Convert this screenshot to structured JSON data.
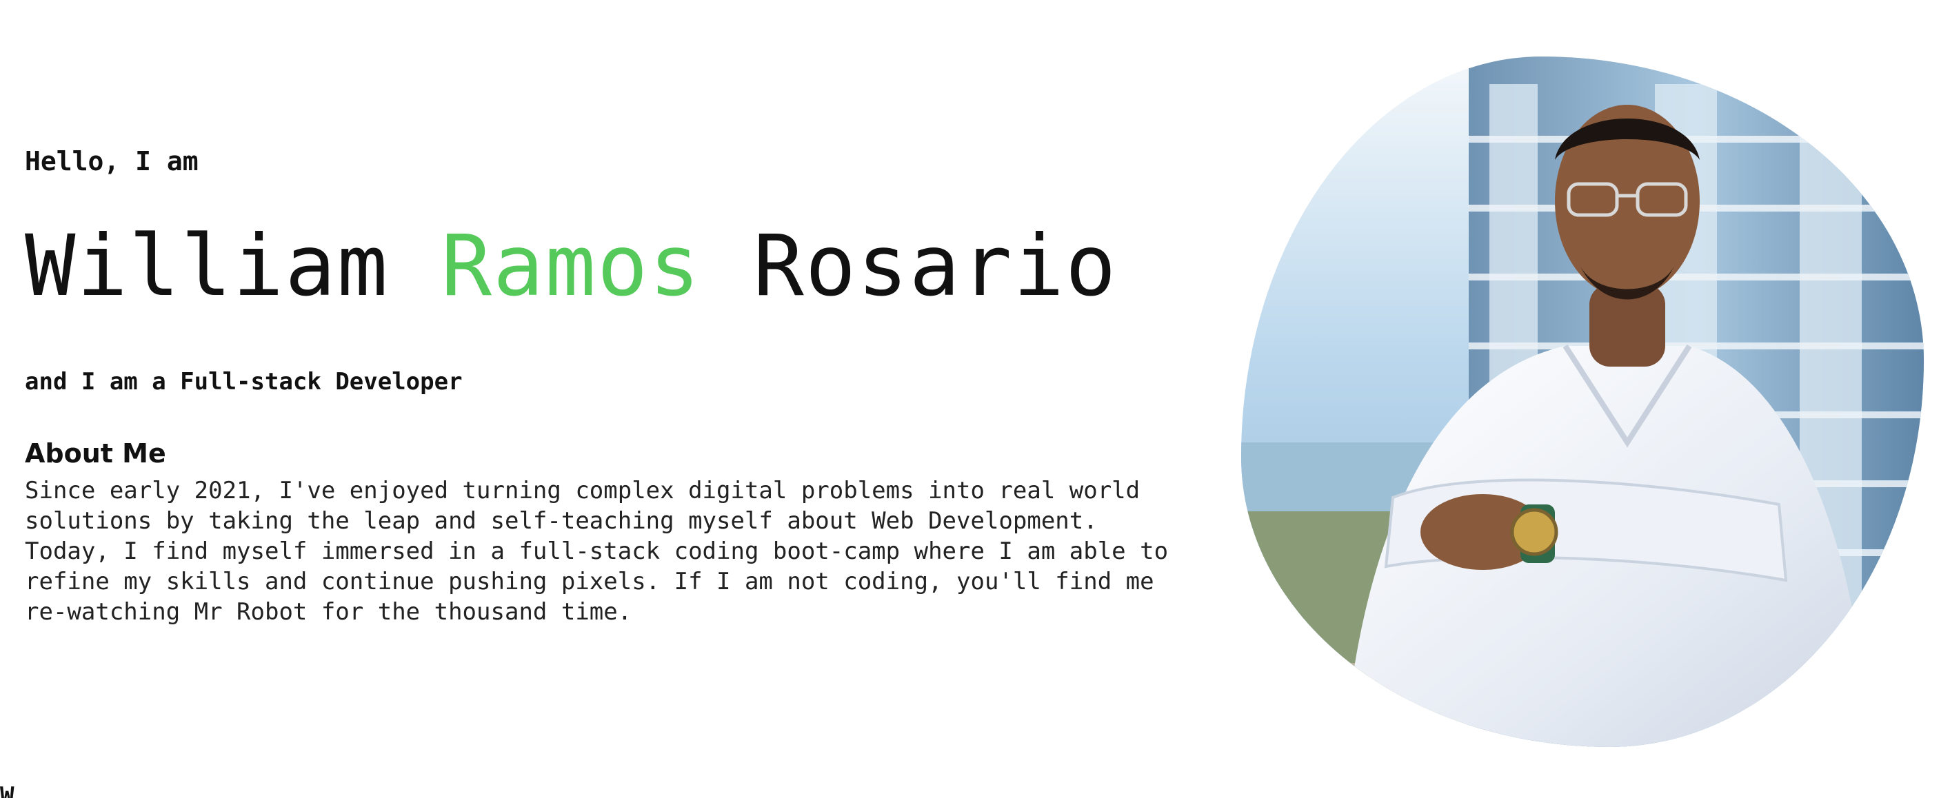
{
  "hero": {
    "greeting": "Hello, I am",
    "name_first": "William",
    "name_middle": "Ramos",
    "name_last": "Rosario",
    "tagline": "and I am a Full-stack Developer",
    "accent_color": "#55c95a"
  },
  "about": {
    "title": "About Me",
    "text": "Since early 2021, I've enjoyed turning complex digital problems into real world solutions by taking the leap and self-teaching myself about Web Development. Today, I find myself immersed in a full-stack coding boot-camp where I am able to refine my skills and continue pushing pixels. If I am not coding, you'll find me re-watching Mr Robot for the thousand time."
  },
  "profile_photo": {
    "icon": "portrait-photo"
  },
  "next_section": {
    "partial_heading": "W"
  }
}
